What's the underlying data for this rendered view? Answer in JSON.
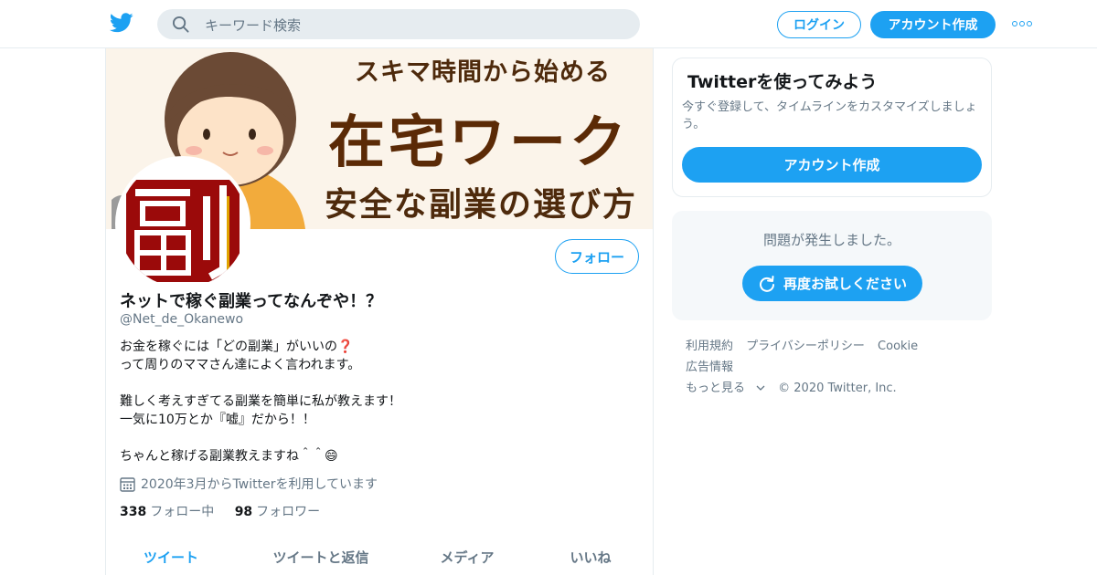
{
  "colors": {
    "accent": "#1da1f2",
    "text": "#14171a",
    "secondary": "#657786",
    "border": "#e6ecf0"
  },
  "header": {
    "search_placeholder": "キーワード検索",
    "login_label": "ログイン",
    "signup_label": "アカウント作成"
  },
  "banner": {
    "line1": "スキマ時間から始める",
    "line2": "在宅ワーク",
    "line3": "安全な副業の選び方"
  },
  "avatar": {
    "glyph": "副"
  },
  "profile": {
    "follow_label": "フォロー",
    "name": "ネットで稼ぐ副業ってなんぞや！？",
    "handle": "@Net_de_Okanewo",
    "bio": {
      "l1": "お金を稼ぐには「どの副業」がいいの❓",
      "l2": "って周りのママさん達によく言われます。",
      "l3": "難しく考えすぎてる副業を簡単に私が教えます！",
      "l4": "一気に10万とか『嘘』だから！！",
      "l5": "ちゃんと稼げる副業教えますね＾＾😄"
    },
    "joined": "2020年3月からTwitterを利用しています",
    "following_count": "338",
    "following_label": "フォロー中",
    "followers_count": "98",
    "followers_label": "フォロワー"
  },
  "tabs": {
    "t1": "ツイート",
    "t2": "ツイートと返信",
    "t3": "メディア",
    "t4": "いいね"
  },
  "signup_card": {
    "title": "Twitterを使ってみよう",
    "text": "今すぐ登録して、タイムラインをカスタマイズしましょう。",
    "button": "アカウント作成"
  },
  "error_card": {
    "text": "問題が発生しました。",
    "retry": "再度お試しください"
  },
  "footer": {
    "terms": "利用規約",
    "privacy": "プライバシーポリシー",
    "cookie": "Cookie",
    "ads": "広告情報",
    "more": "もっと見る",
    "copyright": "© 2020 Twitter, Inc."
  }
}
